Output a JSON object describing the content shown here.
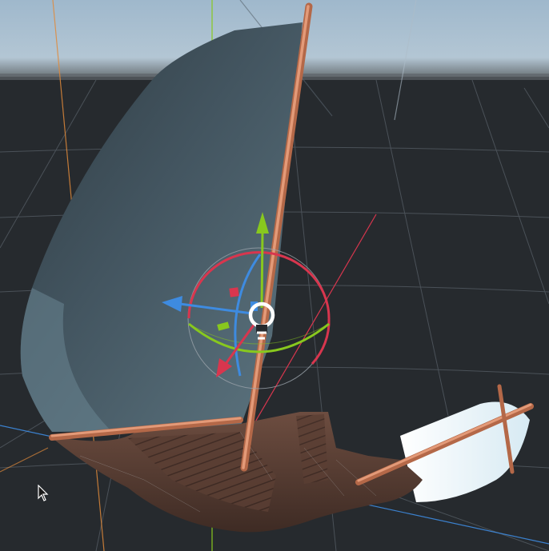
{
  "viewport": {
    "sky_color": "#9fb8cc",
    "horizon_color": "#5e646a",
    "ground_color": "#262a2e",
    "grid_color": "#4d545b"
  },
  "axes": {
    "x_color": "#d8364e",
    "y_color": "#88c81e",
    "z_color": "#3e8be0",
    "aux_color": "#e08a3a"
  },
  "selected_object": {
    "icon": "light-bulb-icon",
    "gizmo": "transform-gizmo"
  },
  "model": {
    "sail_color": "#4d5e66",
    "jib_color": "#e9f4fa",
    "mast_color": "#d98a6a",
    "hull_color": "#5a4138"
  },
  "cursor": {
    "icon": "mouse-pointer-icon"
  }
}
